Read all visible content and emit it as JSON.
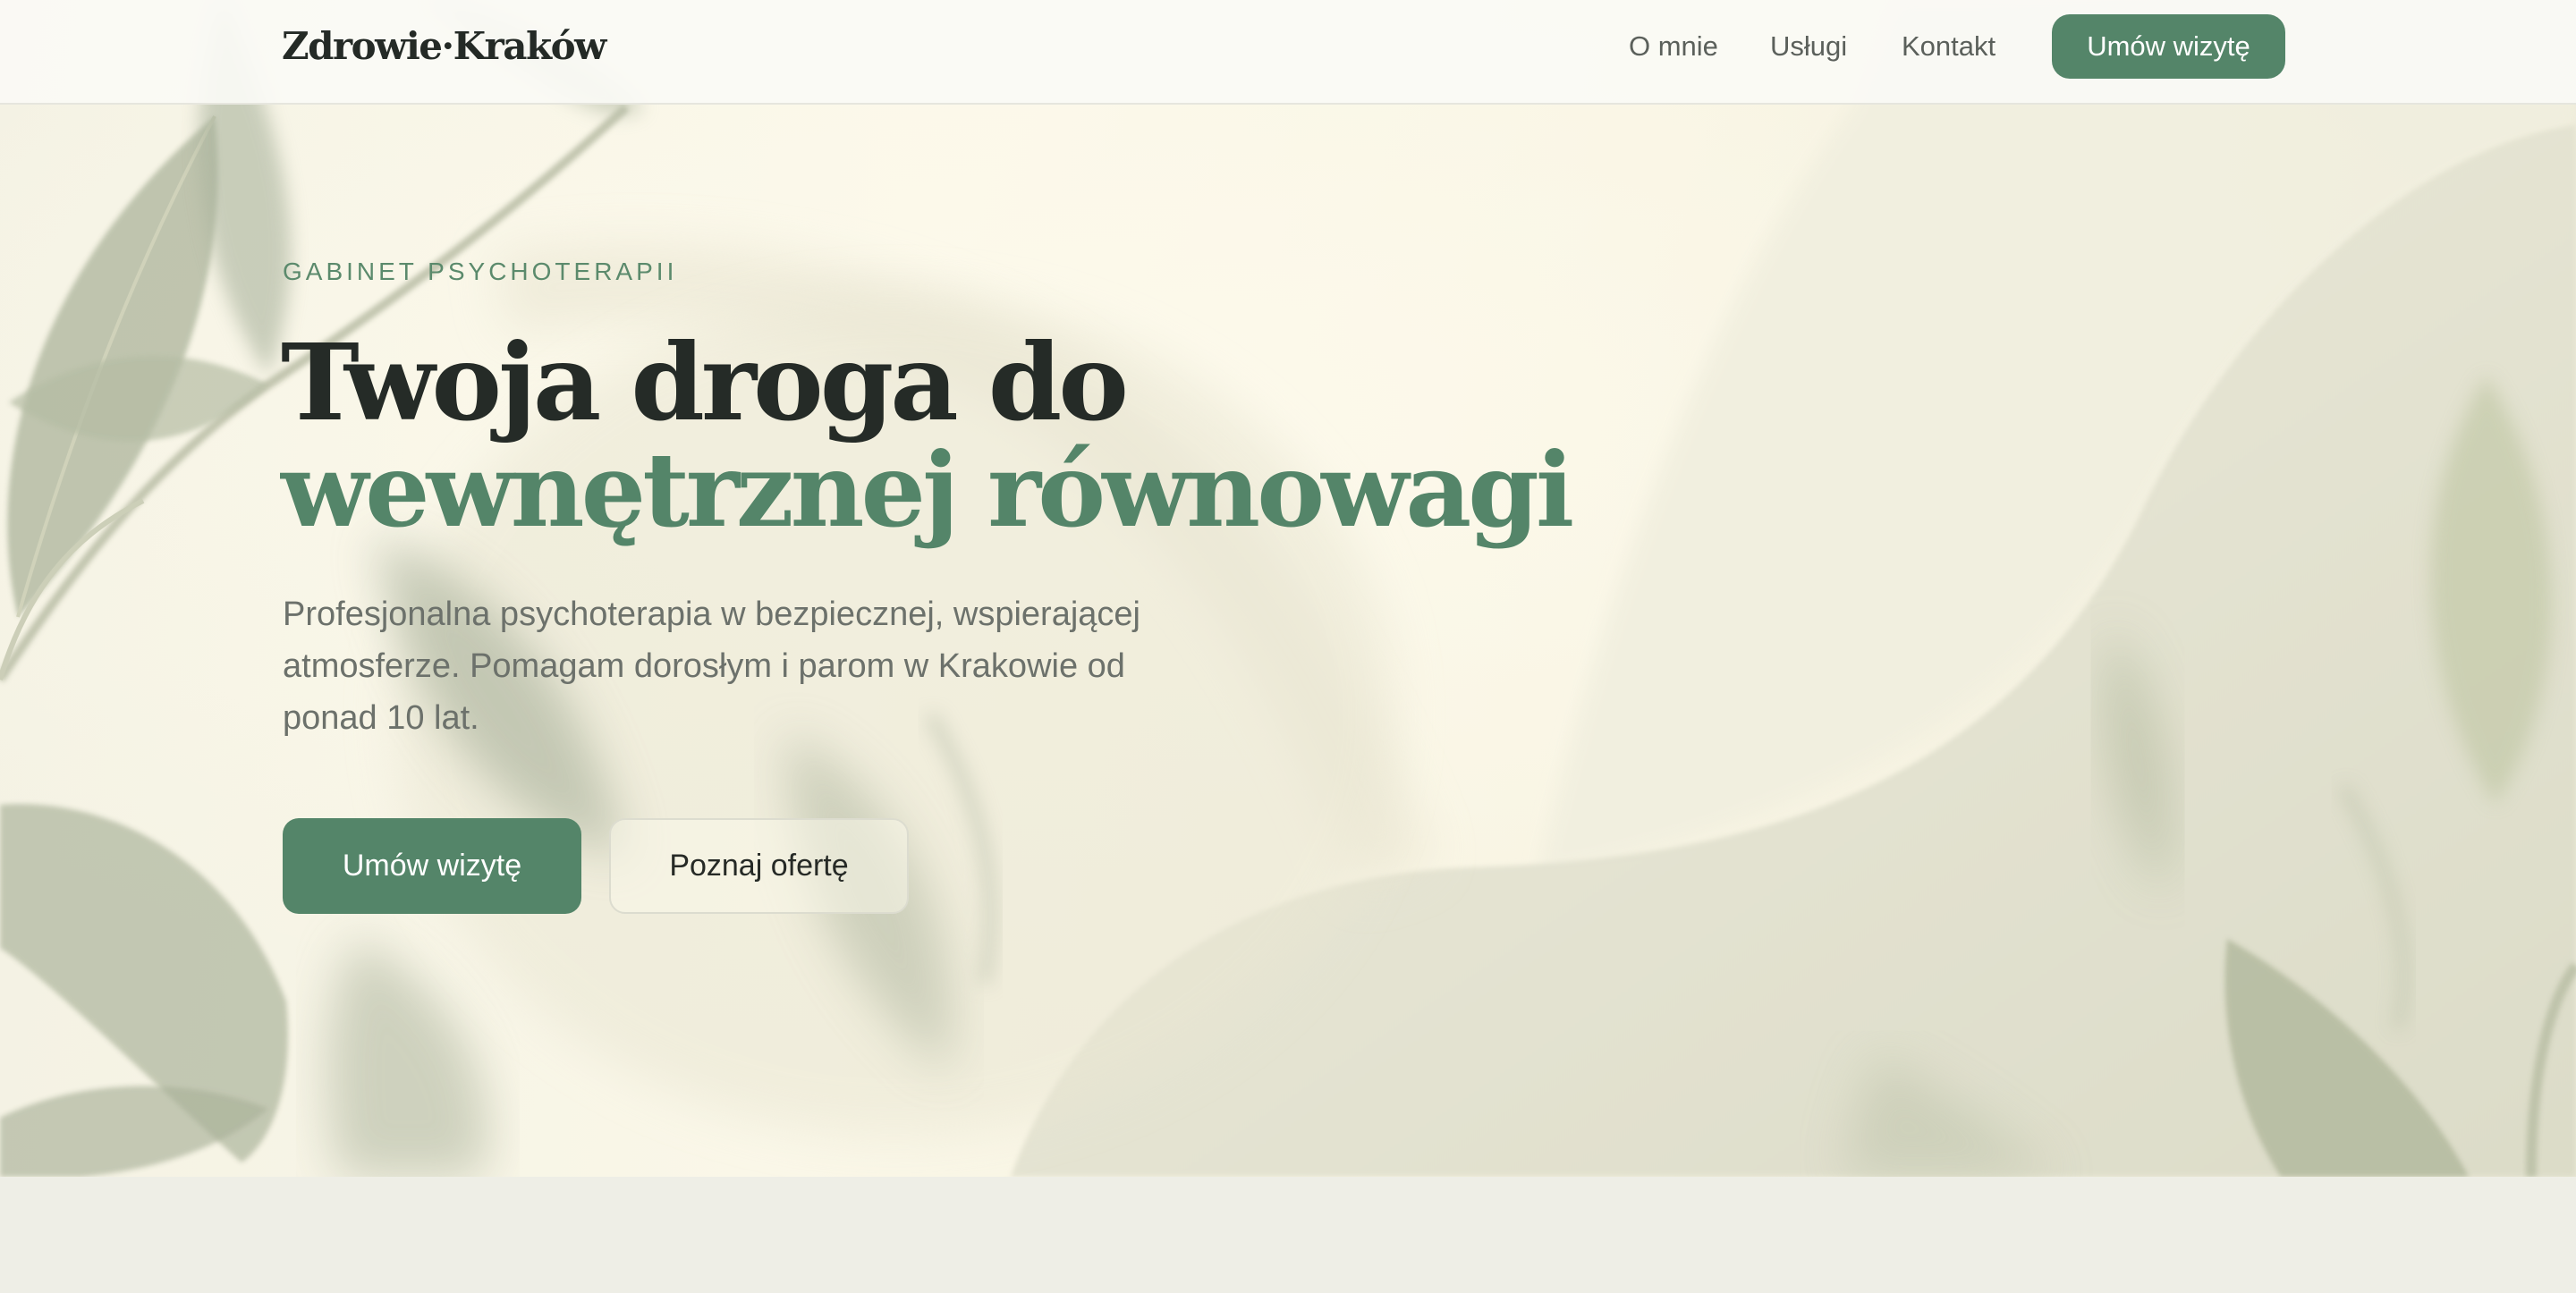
{
  "header": {
    "logo": "Zdrowie·Kraków",
    "nav": [
      {
        "label": "O mnie"
      },
      {
        "label": "Usługi"
      },
      {
        "label": "Kontakt"
      }
    ],
    "cta_label": "Umów wizytę"
  },
  "hero": {
    "eyebrow": "GABINET PSYCHOTERAPII",
    "headline_line1": "Twoja droga do",
    "headline_line2": "wewnętrznej równowagi",
    "lead": "Profesjonalna psychoterapia w bezpiecznej, wspierającej atmosferze. Pomagam dorosłym i parom w Krakowie od ponad 10 lat.",
    "primary_button": "Umów wizytę",
    "secondary_button": "Poznaj ofertę",
    "background_image": "blurred-leaves-photo"
  },
  "colors": {
    "accent": "#548569",
    "heading": "#252b27",
    "body_text": "#6c716b",
    "hero_background": "#f7f3e1",
    "page_background": "#eeeee6"
  }
}
